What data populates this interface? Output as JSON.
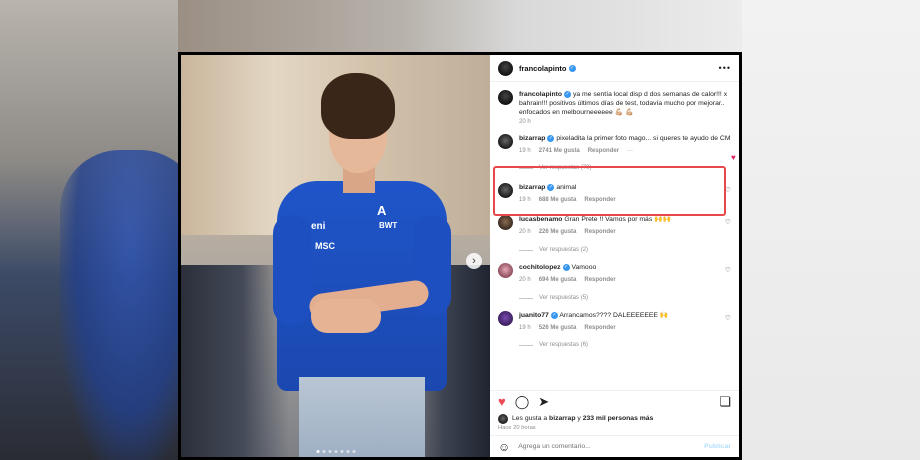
{
  "post": {
    "author": "francolapinto",
    "caption": {
      "author": "francolapinto",
      "text": "ya me sentía local disp d dos semanas de calor!!! x bahrain!!! positivos últimos días de test, todavía mucho por mejorar.. enfocados en melbourneeeeee 💪🏼 💪🏼",
      "time": "20 h"
    },
    "photo": {
      "logos": [
        "A",
        "eni",
        "BWT",
        "MSC"
      ]
    },
    "comments": [
      {
        "author": "bizarrap",
        "verified": true,
        "text": "pixeladita la primer foto mago... si queres te ayudo de CM",
        "time": "19 h",
        "likes": "2741 Me gusta",
        "reply": "Responder",
        "more": "···",
        "replies": "Ver respuestas (70)",
        "highlighted": true
      },
      {
        "author": "bizarrap",
        "verified": true,
        "text": "animal",
        "time": "19 h",
        "likes": "688 Me gusta",
        "reply": "Responder",
        "replies": ""
      },
      {
        "author": "lucasbenamo",
        "verified": false,
        "text": "Gran Prete !! Vamos por más 🙌🙌",
        "time": "20 h",
        "likes": "226 Me gusta",
        "reply": "Responder",
        "replies": "Ver respuestas (2)"
      },
      {
        "author": "cochitolopez",
        "verified": true,
        "text": "Vamooo",
        "time": "20 h",
        "likes": "694 Me gusta",
        "reply": "Responder",
        "replies": "Ver respuestas (5)"
      },
      {
        "author": "juanito77",
        "verified": true,
        "text": "Arrancamos???? DALEEEEEEE 🙌",
        "time": "19 h",
        "likes": "526 Me gusta",
        "reply": "Responder",
        "replies": "Ver respuestas (6)"
      }
    ],
    "likes_line": {
      "prefix": "Les gusta a ",
      "user": "bizarrap",
      "middle": " y ",
      "count": "233 mil personas más"
    },
    "posted_ago": "Hace 20 horas",
    "comment_placeholder": "Agrega un comentario...",
    "publish_label": "Publicar"
  },
  "colors": {
    "highlight": "#e8474c",
    "like": "#ed4956",
    "verified": "#3897f0"
  },
  "icons": [
    "more-icon",
    "heart-icon",
    "comment-icon",
    "share-icon",
    "bookmark-icon",
    "emoji-icon",
    "next-arrow-icon",
    "verified-icon"
  ]
}
